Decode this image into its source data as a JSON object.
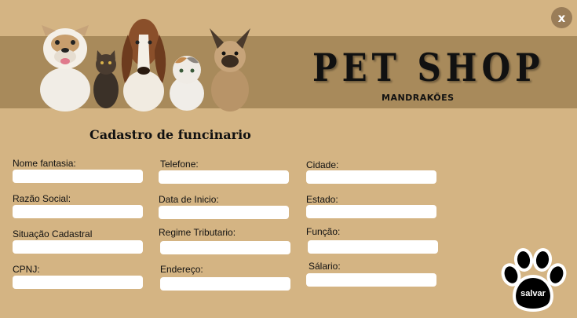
{
  "header": {
    "close_label": "x",
    "brand_title": "PET SHOP",
    "brand_subtitle": "MANDRAKÕES"
  },
  "form": {
    "title": "Cadastro de funcinario",
    "fields": {
      "nome_fantasia": {
        "label": "Nome fantasia:",
        "value": ""
      },
      "razao_social": {
        "label": "Razão Social:",
        "value": ""
      },
      "situacao_cadastral": {
        "label": "Situação Cadastral",
        "value": ""
      },
      "cpnj": {
        "label": "CPNJ:",
        "value": ""
      },
      "telefone": {
        "label": "Telefone:",
        "value": ""
      },
      "data_inicio": {
        "label": "Data de Inicio:",
        "value": ""
      },
      "regime_tributario": {
        "label": "Regime Tributario:",
        "value": ""
      },
      "endereco": {
        "label": "Endereço:",
        "value": ""
      },
      "cidade": {
        "label": "Cidade:",
        "value": ""
      },
      "estado": {
        "label": "Estado:",
        "value": ""
      },
      "funcao": {
        "label": "Função:",
        "value": ""
      },
      "salario": {
        "label": "Sálario:",
        "value": ""
      }
    },
    "save_label": "salvar"
  },
  "colors": {
    "background": "#d4b483",
    "banner": "#a88a5b",
    "close_button": "#9a7d58",
    "paw": "#000000"
  },
  "icons": {
    "close": "close-icon",
    "save": "paw-icon"
  }
}
